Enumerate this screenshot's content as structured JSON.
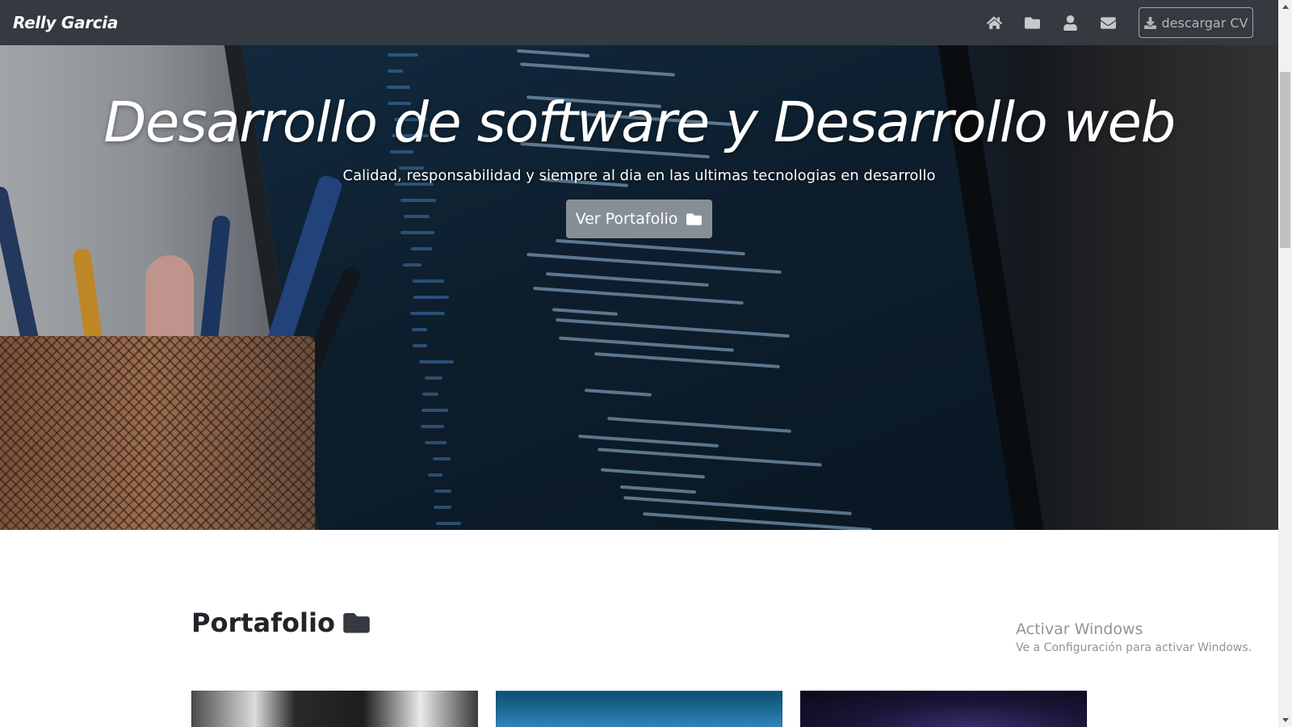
{
  "navbar": {
    "brand": "Relly Garcia",
    "icons": [
      "home-icon",
      "folder-icon",
      "user-icon",
      "envelope-icon"
    ],
    "cv_button": "descargar CV"
  },
  "hero": {
    "title": "Desarrollo de software y Desarrollo web",
    "subtitle": "Calidad, responsabilidad y siempre al dia en las ultimas tecnologias en desarrollo",
    "button": "Ver Portafolio"
  },
  "portfolio": {
    "title": "Portafolio"
  },
  "watermark": {
    "title": "Activar Windows",
    "subtitle": "Ve a Configuración para activar Windows."
  },
  "colors": {
    "navbar": "#343a40",
    "hero_button": "#868e96",
    "text": "#212529"
  }
}
